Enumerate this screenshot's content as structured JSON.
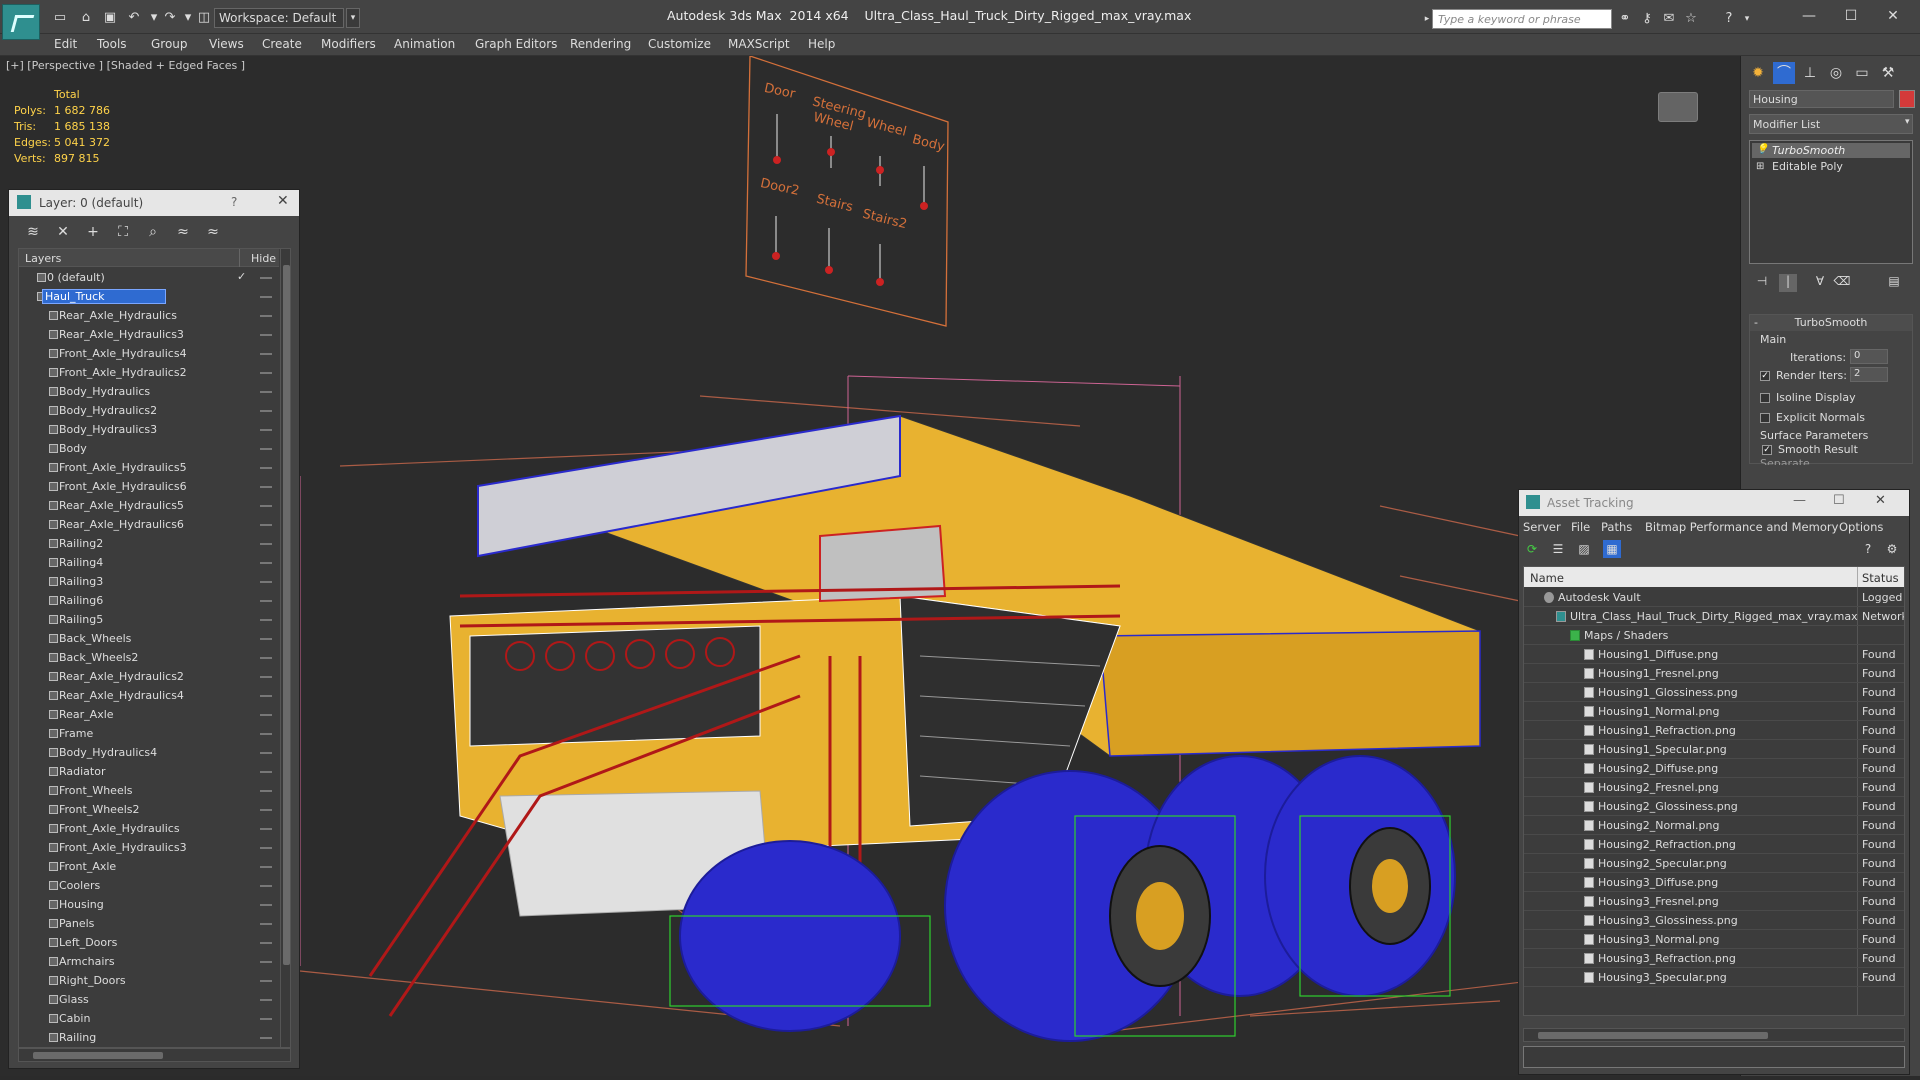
{
  "app": {
    "title": "Autodesk 3ds Max  2014 x64",
    "file": "Ultra_Class_Haul_Truck_Dirty_Rigged_max_vray.max",
    "workspace": "Workspace: Default",
    "search_placeholder": "Type a keyword or phrase"
  },
  "menu": [
    "Edit",
    "Tools",
    "Group",
    "Views",
    "Create",
    "Modifiers",
    "Animation",
    "Graph Editors",
    "Rendering",
    "Customize",
    "MAXScript",
    "Help"
  ],
  "viewport": {
    "label": "[+] [Perspective ] [Shaded + Edged Faces ]",
    "stats": {
      "total_label": "Total",
      "polys_label": "Polys:",
      "polys": "1 682 786",
      "tris_label": "Tris:",
      "tris": "1 685 138",
      "edges_label": "Edges:",
      "edges": "5 041 372",
      "verts_label": "Verts:",
      "verts": "897 815"
    },
    "rig_labels": [
      "Door",
      "Steering Wheel",
      "Wheel",
      "Body",
      "Door2",
      "Stairs",
      "Stairs2"
    ]
  },
  "layer_panel": {
    "title": "Layer: 0 (default)",
    "help": "?",
    "col_layers": "Layers",
    "col_hide": "Hide",
    "layers": [
      {
        "name": "0 (default)",
        "level": 0
      },
      {
        "name": "Haul_Truck",
        "level": 0
      },
      {
        "name": "Rear_Axle_Hydraulics",
        "level": 1
      },
      {
        "name": "Rear_Axle_Hydraulics3",
        "level": 1
      },
      {
        "name": "Front_Axle_Hydraulics4",
        "level": 1
      },
      {
        "name": "Front_Axle_Hydraulics2",
        "level": 1
      },
      {
        "name": "Body_Hydraulics",
        "level": 1
      },
      {
        "name": "Body_Hydraulics2",
        "level": 1
      },
      {
        "name": "Body_Hydraulics3",
        "level": 1
      },
      {
        "name": "Body",
        "level": 1
      },
      {
        "name": "Front_Axle_Hydraulics5",
        "level": 1
      },
      {
        "name": "Front_Axle_Hydraulics6",
        "level": 1
      },
      {
        "name": "Rear_Axle_Hydraulics5",
        "level": 1
      },
      {
        "name": "Rear_Axle_Hydraulics6",
        "level": 1
      },
      {
        "name": "Railing2",
        "level": 1
      },
      {
        "name": "Railing4",
        "level": 1
      },
      {
        "name": "Railing3",
        "level": 1
      },
      {
        "name": "Railing6",
        "level": 1
      },
      {
        "name": "Railing5",
        "level": 1
      },
      {
        "name": "Back_Wheels",
        "level": 1
      },
      {
        "name": "Back_Wheels2",
        "level": 1
      },
      {
        "name": "Rear_Axle_Hydraulics2",
        "level": 1
      },
      {
        "name": "Rear_Axle_Hydraulics4",
        "level": 1
      },
      {
        "name": "Rear_Axle",
        "level": 1
      },
      {
        "name": "Frame",
        "level": 1
      },
      {
        "name": "Body_Hydraulics4",
        "level": 1
      },
      {
        "name": "Radiator",
        "level": 1
      },
      {
        "name": "Front_Wheels",
        "level": 1
      },
      {
        "name": "Front_Wheels2",
        "level": 1
      },
      {
        "name": "Front_Axle_Hydraulics",
        "level": 1
      },
      {
        "name": "Front_Axle_Hydraulics3",
        "level": 1
      },
      {
        "name": "Front_Axle",
        "level": 1
      },
      {
        "name": "Coolers",
        "level": 1
      },
      {
        "name": "Housing",
        "level": 1
      },
      {
        "name": "Panels",
        "level": 1
      },
      {
        "name": "Left_Doors",
        "level": 1
      },
      {
        "name": "Armchairs",
        "level": 1
      },
      {
        "name": "Right_Doors",
        "level": 1
      },
      {
        "name": "Glass",
        "level": 1
      },
      {
        "name": "Cabin",
        "level": 1
      },
      {
        "name": "Railing",
        "level": 1
      }
    ]
  },
  "command_panel": {
    "object_name": "Housing",
    "object_color": "#d43a3a",
    "modifier_list": "Modifier List",
    "stack": [
      "TurboSmooth",
      "Editable Poly"
    ],
    "rollout_title": "TurboSmooth",
    "main_label": "Main",
    "iterations_label": "Iterations:",
    "iterations": "0",
    "render_iters_label": "Render Iters:",
    "render_iters": "2",
    "isoline_label": "Isoline Display",
    "explicit_normals_label": "Explicit Normals",
    "surface_params_label": "Surface Parameters",
    "smooth_result_label": "Smooth Result",
    "separate_label": "Separate"
  },
  "asset_tracking": {
    "title": "Asset Tracking",
    "menu": [
      "Server",
      "File",
      "Paths",
      "Bitmap Performance and Memory",
      "Options"
    ],
    "col_name": "Name",
    "col_status": "Status",
    "rows": [
      {
        "name": "Autodesk Vault",
        "status": "Logged O",
        "level": 0,
        "icon": "vault"
      },
      {
        "name": "Ultra_Class_Haul_Truck_Dirty_Rigged_max_vray.max",
        "status": "Network",
        "level": 1,
        "icon": "max"
      },
      {
        "name": "Maps / Shaders",
        "status": "",
        "level": 2,
        "icon": "folder"
      },
      {
        "name": "Housing1_Diffuse.png",
        "status": "Found",
        "level": 3,
        "icon": "file"
      },
      {
        "name": "Housing1_Fresnel.png",
        "status": "Found",
        "level": 3,
        "icon": "file"
      },
      {
        "name": "Housing1_Glossiness.png",
        "status": "Found",
        "level": 3,
        "icon": "file"
      },
      {
        "name": "Housing1_Normal.png",
        "status": "Found",
        "level": 3,
        "icon": "file"
      },
      {
        "name": "Housing1_Refraction.png",
        "status": "Found",
        "level": 3,
        "icon": "file"
      },
      {
        "name": "Housing1_Specular.png",
        "status": "Found",
        "level": 3,
        "icon": "file"
      },
      {
        "name": "Housing2_Diffuse.png",
        "status": "Found",
        "level": 3,
        "icon": "file"
      },
      {
        "name": "Housing2_Fresnel.png",
        "status": "Found",
        "level": 3,
        "icon": "file"
      },
      {
        "name": "Housing2_Glossiness.png",
        "status": "Found",
        "level": 3,
        "icon": "file"
      },
      {
        "name": "Housing2_Normal.png",
        "status": "Found",
        "level": 3,
        "icon": "file"
      },
      {
        "name": "Housing2_Refraction.png",
        "status": "Found",
        "level": 3,
        "icon": "file"
      },
      {
        "name": "Housing2_Specular.png",
        "status": "Found",
        "level": 3,
        "icon": "file"
      },
      {
        "name": "Housing3_Diffuse.png",
        "status": "Found",
        "level": 3,
        "icon": "file"
      },
      {
        "name": "Housing3_Fresnel.png",
        "status": "Found",
        "level": 3,
        "icon": "file"
      },
      {
        "name": "Housing3_Glossiness.png",
        "status": "Found",
        "level": 3,
        "icon": "file"
      },
      {
        "name": "Housing3_Normal.png",
        "status": "Found",
        "level": 3,
        "icon": "file"
      },
      {
        "name": "Housing3_Refraction.png",
        "status": "Found",
        "level": 3,
        "icon": "file"
      },
      {
        "name": "Housing3_Specular.png",
        "status": "Found",
        "level": 3,
        "icon": "file"
      }
    ]
  },
  "colors": {
    "accent": "#2f6bd1",
    "stats_text": "#ffd34a",
    "truck_body": "#e8b230",
    "wireframe_wheels": "#2a2acc",
    "railing": "#b01818"
  }
}
